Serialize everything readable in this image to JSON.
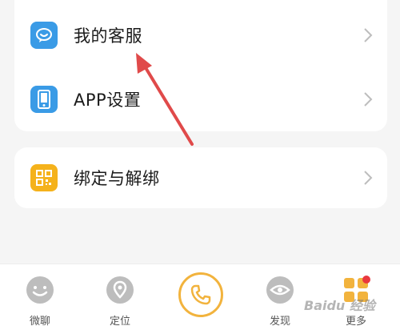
{
  "menu": {
    "items": [
      {
        "label": "我的客服",
        "icon": "chat-icon"
      },
      {
        "label": "APP设置",
        "icon": "phone-settings-icon"
      }
    ]
  },
  "bind_card": {
    "label": "绑定与解绑",
    "icon": "qr-code-icon"
  },
  "tabbar": {
    "tabs": [
      {
        "label": "微聊",
        "icon": "smiley-chat-icon"
      },
      {
        "label": "定位",
        "icon": "location-icon"
      },
      {
        "label": "",
        "icon": "phone-call-icon"
      },
      {
        "label": "发现",
        "icon": "eye-icon"
      },
      {
        "label": "更多",
        "icon": "more-icon"
      }
    ]
  },
  "colors": {
    "accent": "#f2b33d",
    "icon_blue": "#3a9be6",
    "icon_yellow": "#f5b21b",
    "arrow": "#e04a4a",
    "badge": "#e9383f"
  },
  "watermark": "Baidu 经验"
}
